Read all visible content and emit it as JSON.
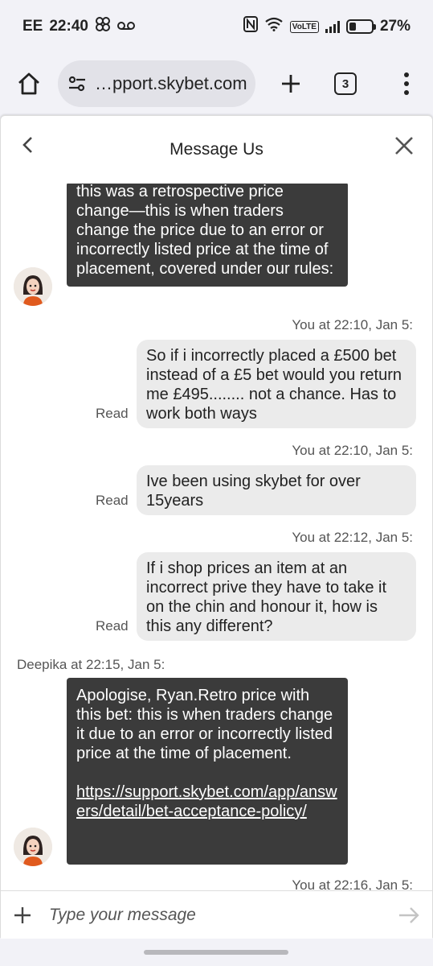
{
  "status_bar": {
    "carrier": "EE",
    "time": "22:40",
    "volte": "VoLTE",
    "battery": "27%"
  },
  "browser": {
    "url": "…pport.skybet.com",
    "tab_count": "3"
  },
  "chat": {
    "title": "Message Us",
    "messages": [
      {
        "from": "agent",
        "text": "this was a retrospective price change—this is when traders change the price due to an error or incorrectly listed price at the time of placement, covered under our rules:"
      },
      {
        "from": "user",
        "meta": "You at 22:10, Jan 5:",
        "text": "So if i incorrectly placed a £500 bet instead of a £5 bet would you return me £495........ not a chance. Has to work both ways",
        "status": "Read"
      },
      {
        "from": "user",
        "meta": "You at 22:10, Jan 5:",
        "text": "Ive been using skybet for over 15years",
        "status": "Read"
      },
      {
        "from": "user",
        "meta": "You at 22:12, Jan 5:",
        "text": "If i shop prices an item at an incorrect prive they have to take it on the chin and honour it, how is this any different?",
        "status": "Read"
      },
      {
        "from": "agent",
        "meta": "Deepika at 22:15, Jan 5:",
        "text": "Apologise, Ryan.Retro price with this bet: this is when traders change it due to an error or incorrectly listed price at the time of placement.",
        "link": "https://support.skybet.com/app/answers/detail/bet-acceptance-policy/"
      },
      {
        "from": "user",
        "meta": "You at 22:16, Jan 5:"
      }
    ],
    "input_placeholder": "Type your message"
  }
}
